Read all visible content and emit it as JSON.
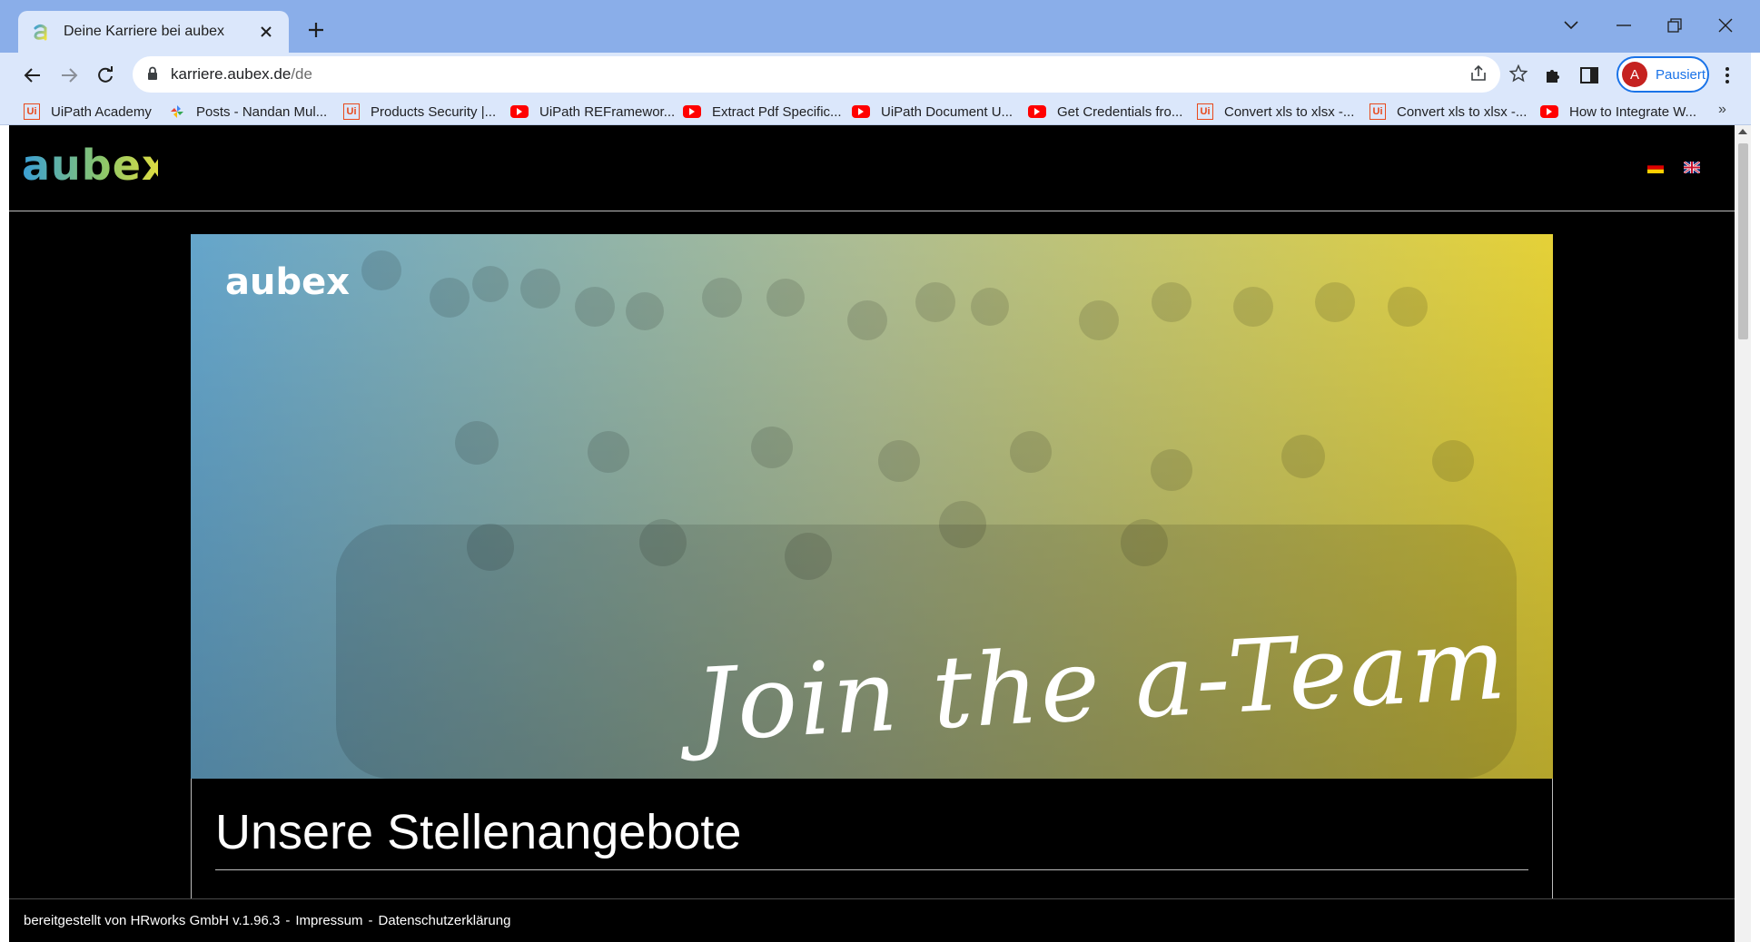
{
  "browser": {
    "tab": {
      "title": "Deine Karriere bei aubex"
    },
    "url": {
      "host": "karriere.aubex.de",
      "path": "/de"
    },
    "profile": {
      "initial": "A",
      "label": "Pausiert"
    },
    "bookmarks": [
      {
        "label": "UiPath Academy",
        "icon": "uipath-icon"
      },
      {
        "label": "Posts - Nandan Mul...",
        "icon": "pinwheel-icon"
      },
      {
        "label": "Products Security |...",
        "icon": "uipath-icon"
      },
      {
        "label": "UiPath REFramewor...",
        "icon": "youtube-icon"
      },
      {
        "label": "Extract Pdf Specific...",
        "icon": "youtube-icon"
      },
      {
        "label": "UiPath Document U...",
        "icon": "youtube-icon"
      },
      {
        "label": "Get Credentials fro...",
        "icon": "youtube-icon"
      },
      {
        "label": "Convert xls to xlsx -...",
        "icon": "uipath-icon"
      },
      {
        "label": "Convert xls to xlsx -...",
        "icon": "uipath-icon"
      },
      {
        "label": "How to Integrate W...",
        "icon": "youtube-icon"
      }
    ],
    "bookmarks_more": "»"
  },
  "page": {
    "logo": "aubex",
    "languages": [
      "de",
      "gb"
    ],
    "hero": {
      "logo": "aubex",
      "tagline": "Join the a-Team"
    },
    "jobs": {
      "title": "Unsere Stellenangebote"
    },
    "footer": {
      "provided_by": "bereitgestellt von HRworks GmbH v.1.96.3",
      "separator": "-",
      "impressum": "Impressum",
      "privacy": "Datenschutzerklärung"
    }
  },
  "colors": {
    "tabstrip": "#8aaee9",
    "toolbar": "#dbe7fb",
    "page_bg": "#000000",
    "logo_gradient": [
      "#3a9fd6",
      "#8cc66a",
      "#f0e23a"
    ],
    "hero_gradient": [
      "#6aaed6",
      "#b7c79a",
      "#f1dc3a"
    ]
  }
}
